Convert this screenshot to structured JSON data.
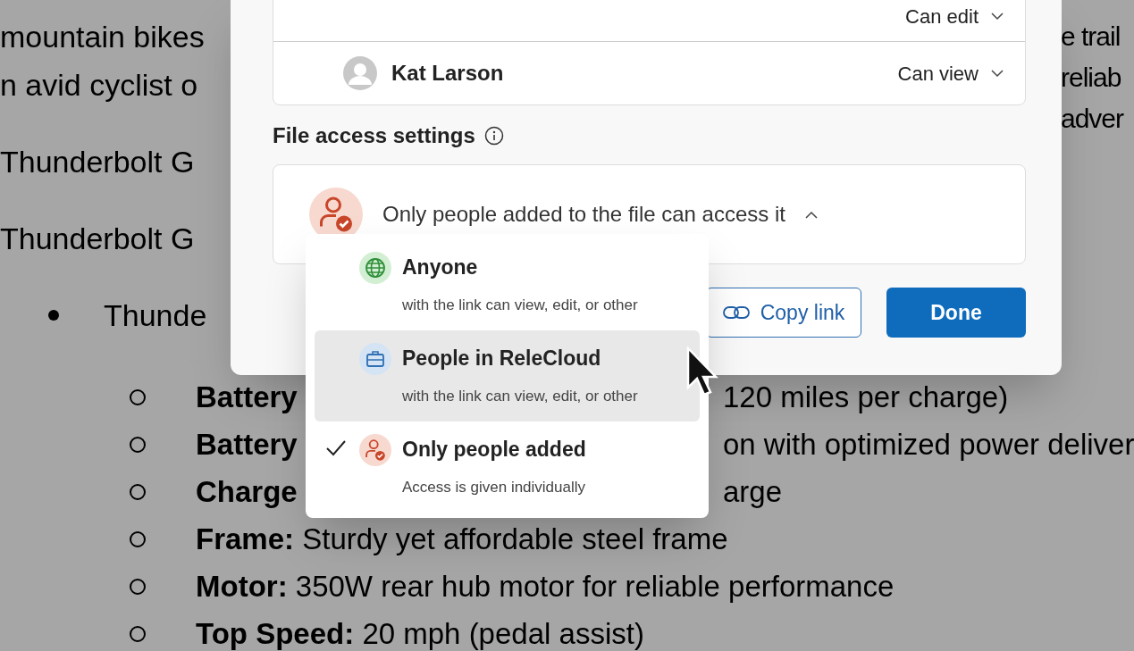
{
  "document": {
    "left_lines": [
      "mountain bikes",
      "n avid cyclist o",
      "Thunderbolt G",
      "Thunderbolt G"
    ],
    "right_lines": [
      "e trail",
      "reliab",
      "adver"
    ],
    "bullet": "Thunde",
    "list": [
      {
        "label": "Battery",
        "text": "120 miles per charge)"
      },
      {
        "label": "Battery",
        "text": "on with optimized power deliver"
      },
      {
        "label": "Charge",
        "text": "arge"
      },
      {
        "label": "Frame:",
        "text": "Sturdy yet affordable steel frame"
      },
      {
        "label": "Motor:",
        "text": "350W rear hub motor for reliable performance"
      },
      {
        "label": "Top Speed:",
        "text": "20 mph (pedal assist)"
      }
    ]
  },
  "dialog": {
    "people": [
      {
        "permission": "Can edit"
      },
      {
        "name": "Kat Larson",
        "permission": "Can view"
      }
    ],
    "section_title": "File access settings",
    "access": {
      "label": "Only people added to the file can access it",
      "expanded": true
    },
    "buttons": [
      {
        "kind": "secondary",
        "label": "Copy link"
      },
      {
        "kind": "primary",
        "label": "Done"
      }
    ]
  },
  "menu": [
    {
      "kind": "anyone",
      "title": "Anyone",
      "subtitle": "with the link can view, edit, or other",
      "selected": false,
      "highlighted": false
    },
    {
      "kind": "organization",
      "title": "People in ReleCloud",
      "subtitle": "with the link can view, edit, or other",
      "selected": false,
      "highlighted": true
    },
    {
      "kind": "specific",
      "title": "Only people added",
      "subtitle": "Access is given individually",
      "selected": true,
      "highlighted": false
    }
  ]
}
